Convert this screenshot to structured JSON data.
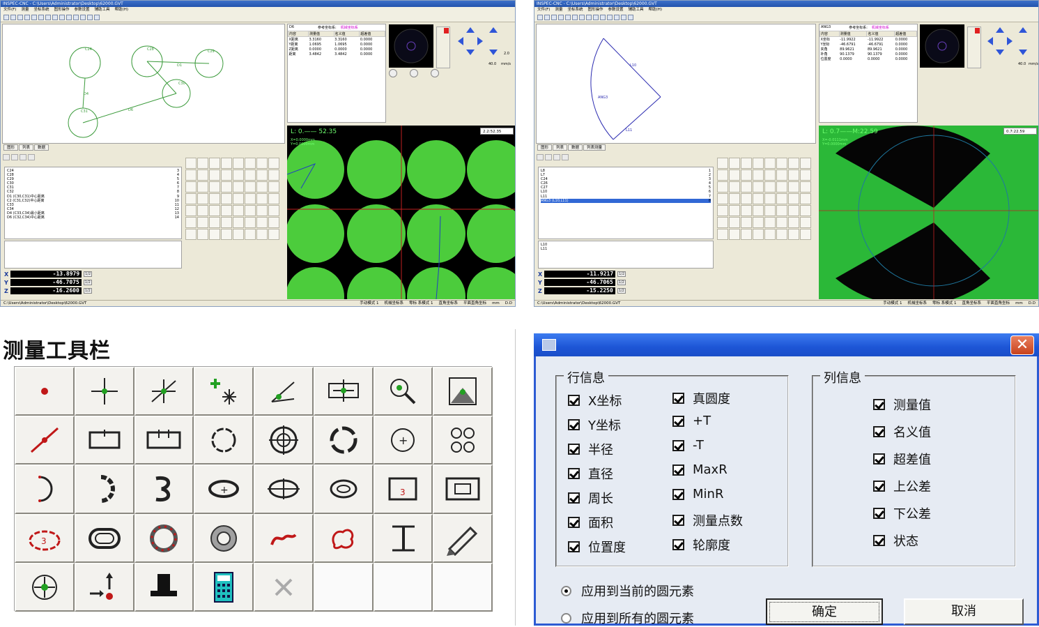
{
  "app": {
    "title": "INSPEC-CNC - C:\\Users\\Administrator\\Desktop\\62000.GVT",
    "menu": [
      "文件(F)",
      "测量",
      "坐标系统",
      "图形操作",
      "参数设置",
      "辅助工具",
      "帮助(H)"
    ],
    "status_path": "C:\\Users\\Administrator\\Desktop\\62000.GVT",
    "status_items": [
      "手动模式 1",
      "机械坐标系",
      "零标 系模式 1",
      "直角坐标系",
      "平面直角坐标",
      "mm",
      "D.D"
    ],
    "table_headers": [
      "内容",
      "测量值",
      "名义值",
      "超差值"
    ],
    "panel_tabs_left": [
      "图形",
      "列表",
      "数据"
    ],
    "panel_tabs_right": [
      "图形",
      "列表",
      "数据",
      "列表测量"
    ],
    "feed_rate": "2.0",
    "speed": "40.0",
    "speed_unit": "mm/s"
  },
  "window_left": {
    "element_label": "D6",
    "coord_sys_label": "参考坐标系:",
    "coord_sys_value": "机械坐标系",
    "rows": [
      [
        "X距离",
        "3.3160",
        "3.3160",
        "0.0000"
      ],
      [
        "Y距离",
        "1.0695",
        "1.0695",
        "0.0000"
      ],
      [
        "Z距离",
        "0.0000",
        "0.0000",
        "0.0000"
      ],
      [
        "距离",
        "3.4842",
        "3.4842",
        "0.0000"
      ]
    ],
    "features": [
      "C24",
      "C28",
      "C29",
      "C30",
      "C31",
      "C32",
      "D1 (C30,C31)中心距离",
      "C2 (C31,C32)中心距离",
      "C33",
      "C34",
      "D4 (C33,C34)最小距离",
      "D6 (C32,C34)中心距离"
    ],
    "feature_numbers": [
      "3",
      "4",
      "5",
      "6",
      "7",
      "8",
      "9",
      "10",
      "11",
      "12",
      "13",
      "14"
    ],
    "camera_readout": "L: 0.—— 52.35",
    "camera_sub": [
      "X=0.0000mm",
      "Y=0.0000mm"
    ],
    "camera_zoom": "2.2:52.35",
    "plot_labels": [
      "C24",
      "C28",
      "C29",
      "C30",
      "C31",
      "D1",
      "D4",
      "D6"
    ],
    "x": "-13.8979",
    "y": "-46.7075",
    "z": "-16.2600"
  },
  "window_right": {
    "element_label": "ANG3",
    "coord_sys_label": "参考坐标系:",
    "coord_sys_value": "机械坐标系",
    "rows": [
      [
        "X坐标",
        "-11.9922",
        "-11.9922",
        "0.0000"
      ],
      [
        "Y坐标",
        "-46.6791",
        "-46.6791",
        "0.0000"
      ],
      [
        "夹角",
        "89.9621",
        "89.9621",
        "0.0000"
      ],
      [
        "补角",
        "90.1379",
        "90.1379",
        "0.0000"
      ],
      [
        "位置度",
        "0.0000",
        "0.0000",
        "0.0000"
      ]
    ],
    "features": [
      "L8",
      "L7",
      "C24",
      "C26",
      "C27",
      "L10",
      "L11",
      "ANG3 (L10,L11)"
    ],
    "feature_numbers": [
      "1",
      "2",
      "3",
      "4",
      "5",
      "6",
      "7",
      "8"
    ],
    "bottom_list": [
      "L10",
      "L11"
    ],
    "camera_readout": "L: 0.7——M:22.59",
    "camera_sub": [
      "X=-0.0111mm",
      "Y=0.0000mm"
    ],
    "camera_zoom": "0.7:22.59",
    "plot_labels": [
      "L10",
      "L11",
      "ANG3"
    ],
    "x": "-11.9217",
    "y": "-46.7065",
    "z": "-15.2250"
  },
  "toolbar_panel": {
    "title": "测量工具栏",
    "buttons": [
      "point-icon",
      "crosshair-point-icon",
      "intersection-point-icon",
      "auto-point-icon",
      "angle-point-icon",
      "edge-point-icon",
      "zoom-point-icon",
      "peak-point-icon",
      "line-icon",
      "rectangle-icon",
      "double-rectangle-icon",
      "circle-icon",
      "crosshair-circle-icon",
      "arc-circle-icon",
      "center-circle-icon",
      "four-circles-icon",
      "arc-icon",
      "partial-arc-icon",
      "spline-arc-icon",
      "ellipse-icon",
      "crosshair-ellipse-icon",
      "ring-icon",
      "slot-icon",
      "keyway-icon",
      "gear-shape-icon",
      "oval-ring-icon",
      "dotted-ring-icon",
      "thick-ring-icon",
      "curve-icon",
      "blob-icon",
      "height-icon",
      "pen-icon",
      "center-point-icon",
      "move-point-icon",
      "probe-icon",
      "calculator-icon",
      "disabled-cross-icon",
      "blank",
      "blank",
      "blank"
    ]
  },
  "dialog": {
    "row_group_title": "行信息",
    "col_group_title": "列信息",
    "row_left": [
      "X坐标",
      "Y坐标",
      "半径",
      "直径",
      "周长",
      "面积",
      "位置度"
    ],
    "row_right": [
      "真圆度",
      "+T",
      "-T",
      "MaxR",
      "MinR",
      "测量点数",
      "轮廓度"
    ],
    "col_items": [
      "测量值",
      "名义值",
      "超差值",
      "上公差",
      "下公差",
      "状态"
    ],
    "radio_current": "应用到当前的圆元素",
    "radio_all": "应用到所有的圆元素",
    "ok": "确定",
    "cancel": "取消"
  }
}
